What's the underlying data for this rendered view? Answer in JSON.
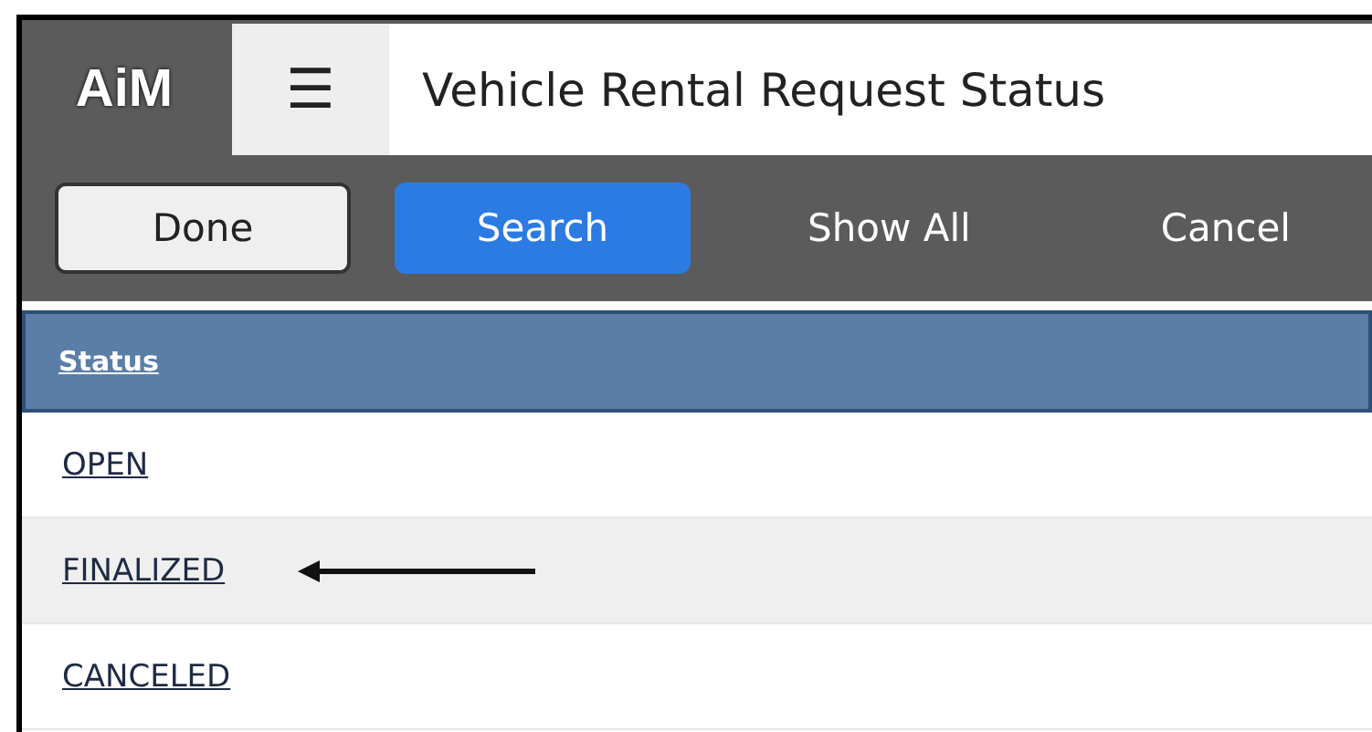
{
  "app": {
    "logo": "AiM",
    "menu_icon": "☰",
    "title": "Vehicle Rental Request Status"
  },
  "toolbar": [
    {
      "label": "Done",
      "kind": "plain"
    },
    {
      "label": "Search",
      "kind": "primary"
    },
    {
      "label": "Show All",
      "kind": "text"
    },
    {
      "label": "Cancel",
      "kind": "text"
    }
  ],
  "table": {
    "columns": [
      "Status"
    ],
    "rows": [
      {
        "status": "OPEN",
        "marked": false
      },
      {
        "status": "FINALIZED",
        "marked": true
      },
      {
        "status": "CANCELED",
        "marked": false
      }
    ]
  }
}
